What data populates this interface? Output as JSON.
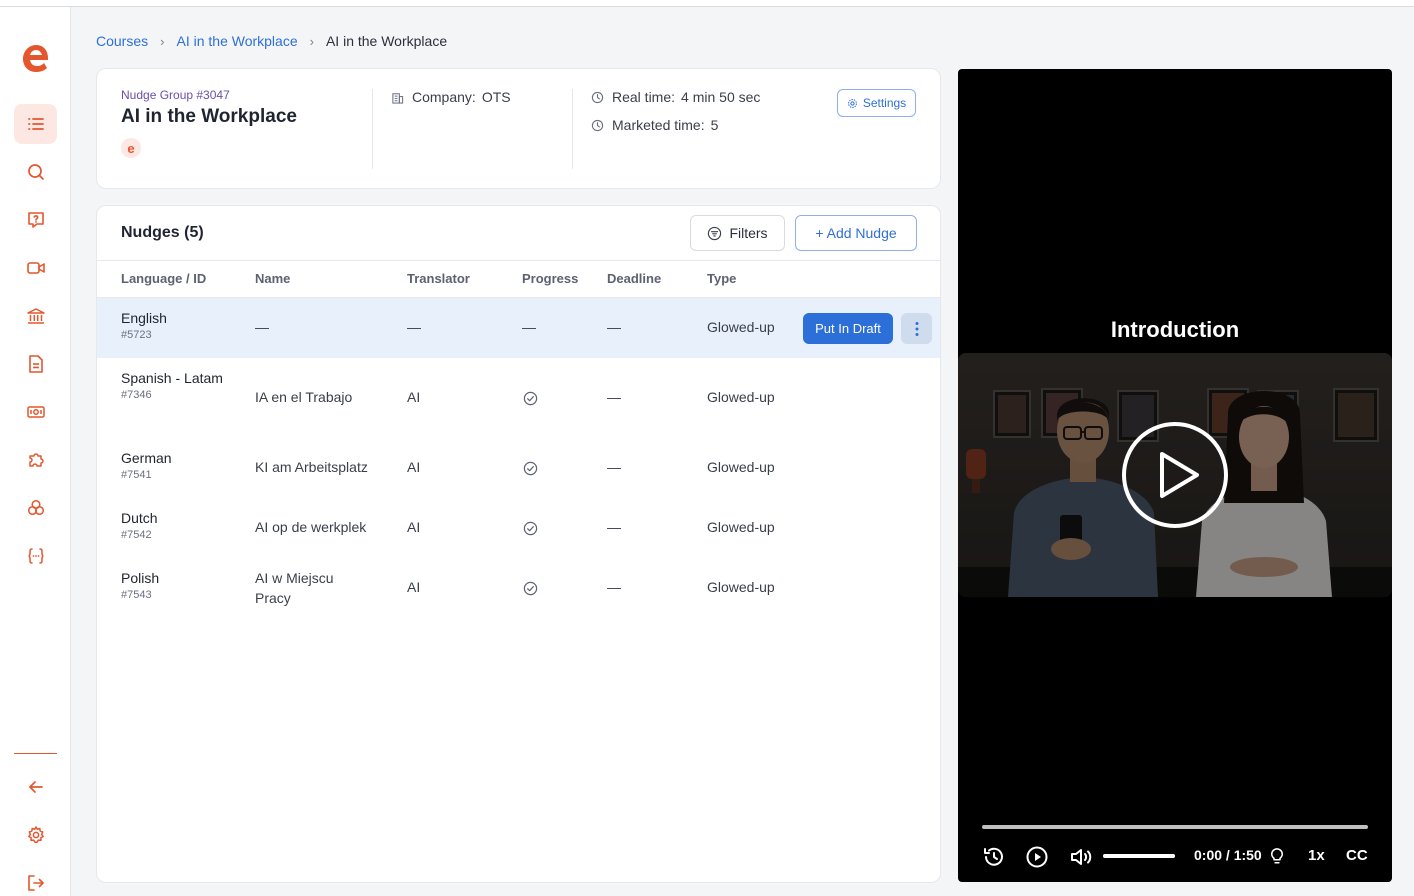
{
  "breadcrumb": {
    "items": [
      "Courses",
      "AI in the Workplace"
    ],
    "current": "AI in the Workplace"
  },
  "sidebar": {
    "logo_icon": "e-logo-icon",
    "items": [
      {
        "icon": "list-icon",
        "active": true
      },
      {
        "icon": "search-icon",
        "active": false
      },
      {
        "icon": "question-chat-icon",
        "active": false
      },
      {
        "icon": "video-camera-icon",
        "active": false
      },
      {
        "icon": "bank-icon",
        "active": false
      },
      {
        "icon": "document-icon",
        "active": false
      },
      {
        "icon": "ticket-icon",
        "active": false
      },
      {
        "icon": "puzzle-icon",
        "active": false
      },
      {
        "icon": "circles-icon",
        "active": false
      },
      {
        "icon": "variable-icon",
        "active": false
      }
    ],
    "bottom": [
      "back-arrow-icon",
      "gear-icon",
      "logout-icon"
    ],
    "accent_color": "#e4572e"
  },
  "header": {
    "group_id": "Nudge Group #3047",
    "title": "AI in the Workplace",
    "badge_letter": "e",
    "company_label": "Company:",
    "company_value": "OTS",
    "real_time_label": "Real time:",
    "real_time_value": "4 min 50 sec",
    "marketed_time_label": "Marketed time:",
    "marketed_time_value": "5",
    "settings_label": "Settings"
  },
  "nudges": {
    "title": "Nudges (5)",
    "filters_label": "Filters",
    "add_label": "+ Add Nudge",
    "columns": [
      "Language / ID",
      "Name",
      "Translator",
      "Progress",
      "Deadline",
      "Type"
    ],
    "rows": [
      {
        "language": "English",
        "id": "#5723",
        "name": "—",
        "translator": "—",
        "progress": "—",
        "deadline": "—",
        "type": "Glowed-up",
        "selected": true,
        "action_label": "Put In Draft"
      },
      {
        "language": "Spanish - Latam",
        "id": "#7346",
        "name": "IA en el Trabajo",
        "translator": "AI",
        "progress": "check",
        "deadline": "—",
        "type": "Glowed-up"
      },
      {
        "language": "German",
        "id": "#7541",
        "name": "KI am Arbeitsplatz",
        "translator": "AI",
        "progress": "check",
        "deadline": "—",
        "type": "Glowed-up"
      },
      {
        "language": "Dutch",
        "id": "#7542",
        "name": "AI op de werkplek",
        "translator": "AI",
        "progress": "check",
        "deadline": "—",
        "type": "Glowed-up"
      },
      {
        "language": "Polish",
        "id": "#7543",
        "name": "AI w Miejscu Pracy",
        "translator": "AI",
        "progress": "check",
        "deadline": "—",
        "type": "Glowed-up"
      }
    ]
  },
  "video": {
    "title": "Introduction",
    "time": "0:00 / 1:50",
    "speed": "1x",
    "captions": "CC",
    "progress": 0
  },
  "colors": {
    "primary": "#2c6fd9",
    "selected_row": "#e8f0fc",
    "brand": "#e4572e"
  }
}
